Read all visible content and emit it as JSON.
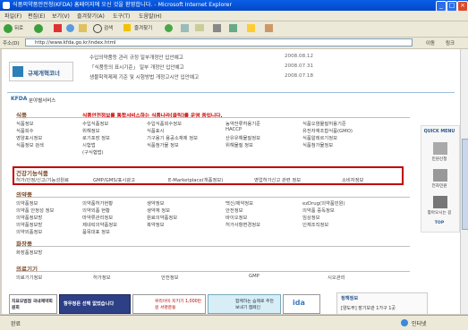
{
  "window": {
    "title": "식품의약품안전청(KFDA) 홈페이지에 오신 것을 환영합니다. - Microsoft Internet Explorer"
  },
  "menu": [
    "파일(F)",
    "편집(E)",
    "보기(V)",
    "즐겨찾기(A)",
    "도구(T)",
    "도움말(H)"
  ],
  "toolbar": {
    "back": "뒤로",
    "search": "검색",
    "favorites": "즐겨찾기"
  },
  "address": {
    "label": "주소(D)",
    "url": "http://www.kfda.go.kr/index.html",
    "go": "이동",
    "links": "링크"
  },
  "news": [
    {
      "text": "수입의약품등 관리 규정 일부개정안 입안예고",
      "date": "2008.08.12"
    },
    {
      "text": "「식품등의 표시기준」 일부 개정안 입안예고",
      "date": "2008.07.31"
    },
    {
      "text": "생물학적제제 기준 및 시험방법 개정고시안 입안예고",
      "date": "2008.07.18"
    }
  ],
  "reg_corner": "규제개혁코너",
  "field_tab": "분야별서비스",
  "food": {
    "title": "식품",
    "notice": "식품안전정보를 통합서비스하는 식품나라(클릭)를 운영 중입니다.",
    "rows": [
      [
        "식품정보",
        "수입식품정보",
        "수입식품회수정보",
        "농약잔류허용기준",
        "식품오염물질허용기준"
      ],
      [
        "식품회수",
        "위해정보",
        "식품표시",
        "HACCP",
        "유전자재조합식품(GMO)"
      ],
      [
        "영양표시정보",
        "로기포장 정보",
        "기구용기 용공소재제 정보",
        "산유유해물질정보",
        "식품알레르기정보"
      ],
      [
        "식품정보 검색",
        "시험법",
        "식품첨가물 정보",
        "위해물질 정보",
        "식품첨가물정보"
      ],
      [
        "",
        "(구식협법)",
        "",
        "",
        ""
      ]
    ]
  },
  "health_food": {
    "title": "건강기능식품",
    "items": [
      "허가/인정/신고/기능성원료",
      "GMP/GMS/표시광고",
      "E-Marketplace(개품정보)",
      "영업허가신고 관련 정보",
      "소비자정보"
    ]
  },
  "drug": {
    "title": "의약품",
    "rows": [
      [
        "의약품정보",
        "의약품허가현황",
        "생약정보",
        "백신/제약정보",
        "ezDrug(의약품민원)"
      ],
      [
        "의약품 안정성 정보",
        "의약외품 현황",
        "생약재 정보",
        "안전정보",
        "의약품 중독정보"
      ],
      [
        "의약품정보방",
        "마약류관리정보",
        "원료의약품정보",
        "바이오정보",
        "임상정보"
      ],
      [
        "의약품정보방",
        "제네릭의약품정보",
        "복약정보",
        "허가사항변경정보",
        "인체조직정보"
      ],
      [
        "의약외품정보",
        "품목대표 정보",
        "",
        "",
        ""
      ]
    ]
  },
  "cosmetic": {
    "title": "화장품",
    "items": [
      "화장품정보방"
    ]
  },
  "device": {
    "title": "의료기기",
    "items": [
      "의료기기정보",
      "허가정보",
      "안전정보",
      "GMP",
      "시오관리"
    ]
  },
  "quick": {
    "title": "QUICK MENU",
    "items": [
      "민원신청",
      "전자민원",
      "찾아오시는 길"
    ],
    "top": "TOP"
  },
  "banners": [
    "지표모범점 국내제약회원회",
    "항우정은 선택 없었습니다",
    "우리아이 지키기 1,000만원 서명운동",
    "함께하는 습제로 추천 보내기 캠페인",
    "ida"
  ],
  "policy": {
    "title": "정책정보",
    "item": "[양도부] 장기보관 1가구 1곳"
  },
  "status": {
    "left": "완료",
    "zone": "인터넷"
  },
  "colors": {
    "title_bar": "#0a5ee6",
    "accent": "#cc0000",
    "section": "#7b4a2a",
    "highlight_border": "#c00000"
  }
}
